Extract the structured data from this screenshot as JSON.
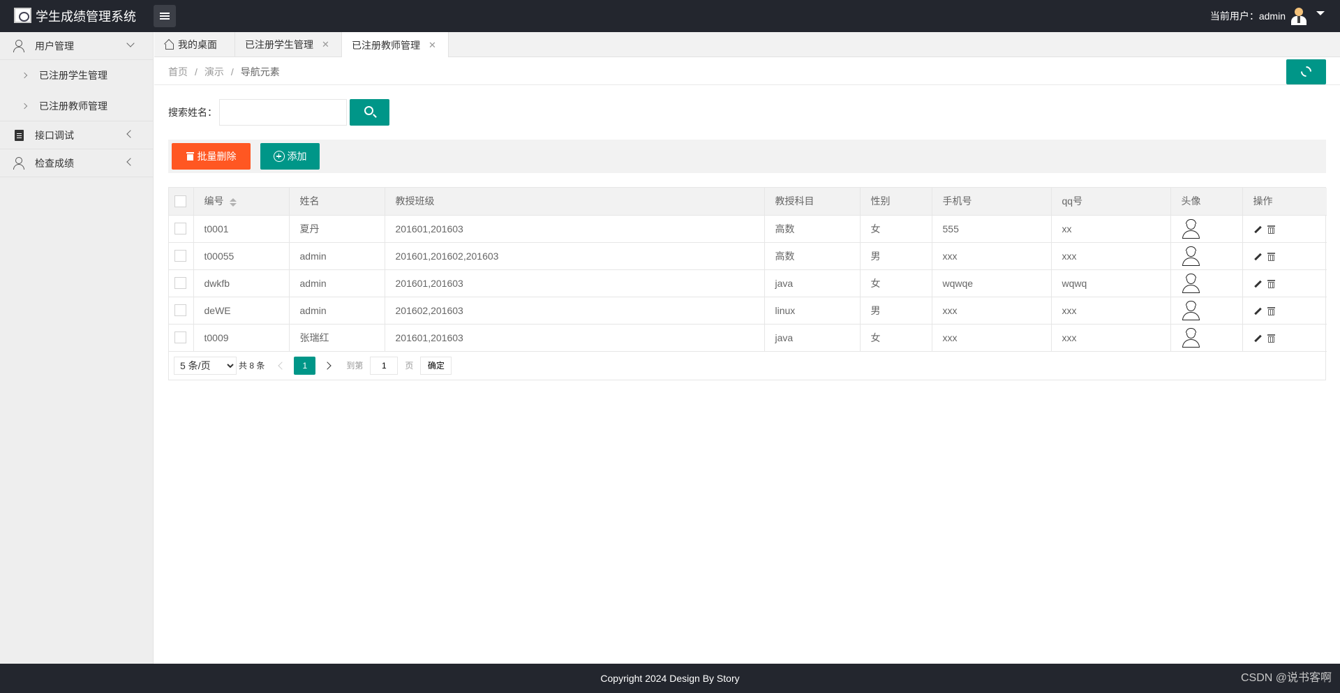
{
  "header": {
    "brand": "学生成绩管理系统",
    "current_user_label": "当前用户：admin"
  },
  "sidebar": {
    "groups": [
      {
        "label": "用户管理",
        "icon": "user-icon",
        "expanded": true,
        "items": [
          {
            "label": "已注册学生管理"
          },
          {
            "label": "已注册教师管理"
          }
        ]
      },
      {
        "label": "接口调试",
        "icon": "document-icon",
        "expanded": false
      },
      {
        "label": "检查成绩",
        "icon": "user-icon",
        "expanded": false
      }
    ]
  },
  "tabs": [
    {
      "label": "我的桌面",
      "icon": "home-icon",
      "closable": false
    },
    {
      "label": "已注册学生管理",
      "closable": true
    },
    {
      "label": "已注册教师管理",
      "closable": true,
      "active": true
    }
  ],
  "breadcrumb": [
    "首页",
    "演示",
    "导航元素"
  ],
  "search": {
    "label": "搜索姓名：",
    "value": "",
    "placeholder": ""
  },
  "toolbar": {
    "batch_delete": "批量删除",
    "add": "添加"
  },
  "table": {
    "columns": [
      "编号",
      "姓名",
      "教授班级",
      "教授科目",
      "性别",
      "手机号",
      "qq号",
      "头像",
      "操作"
    ],
    "rows": [
      {
        "id": "t0001",
        "name": "夏丹",
        "classes": "201601,201603",
        "subject": "高数",
        "gender": "女",
        "phone": "555",
        "qq": "xx"
      },
      {
        "id": "t00055",
        "name": "admin",
        "classes": "201601,201602,201603",
        "subject": "高数",
        "gender": "男",
        "phone": "xxx",
        "qq": "xxx"
      },
      {
        "id": "dwkfb",
        "name": "admin",
        "classes": "201601,201603",
        "subject": "java",
        "gender": "女",
        "phone": "wqwqe",
        "qq": "wqwq"
      },
      {
        "id": "deWE",
        "name": "admin",
        "classes": "201602,201603",
        "subject": "linux",
        "gender": "男",
        "phone": "xxx",
        "qq": "xxx"
      },
      {
        "id": "t0009",
        "name": "张瑞红",
        "classes": "201601,201603",
        "subject": "java",
        "gender": "女",
        "phone": "xxx",
        "qq": "xxx"
      }
    ]
  },
  "pagination": {
    "page_size": "5 条/页",
    "total": "共 8 条",
    "current_page": "1",
    "goto_label": "到第",
    "goto_value": "1",
    "page_unit": "页",
    "confirm": "确定"
  },
  "footer": {
    "copyright": "Copyright 2024 Design By Story",
    "watermark": "CSDN @说书客啊"
  },
  "colors": {
    "header_bg": "#23262e",
    "primary": "#009688",
    "danger": "#ff5722"
  }
}
